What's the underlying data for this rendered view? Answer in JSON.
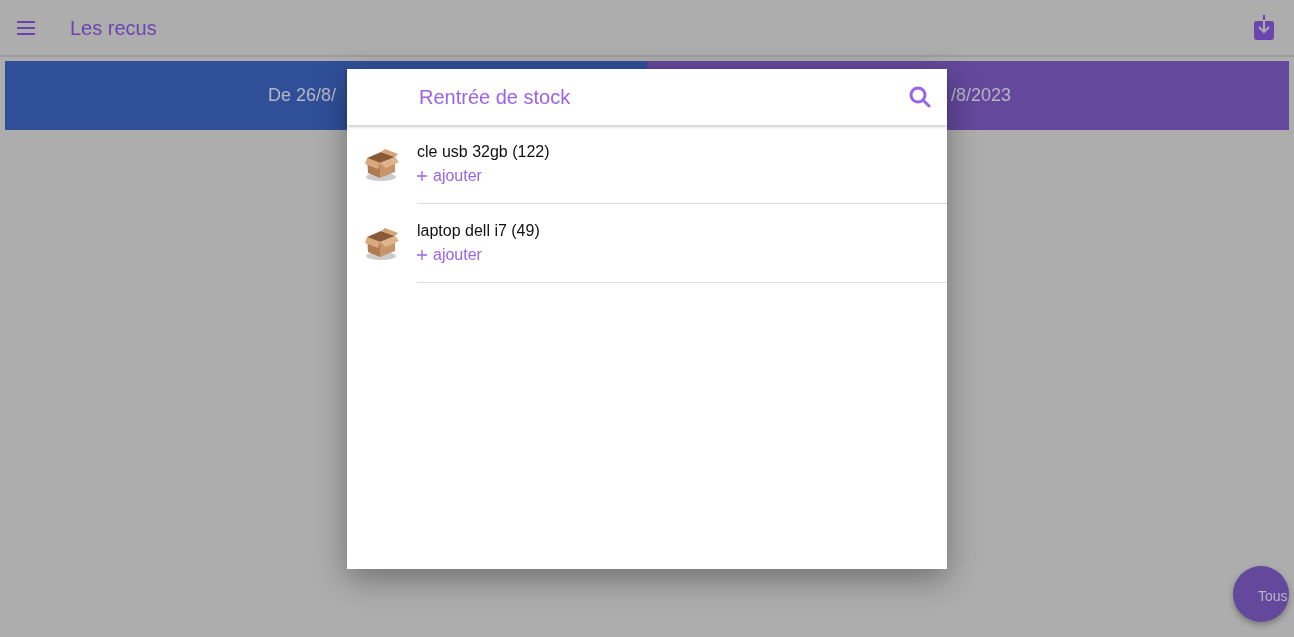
{
  "app_bar": {
    "title": "Les recus"
  },
  "date_tabs": [
    {
      "label": "De 26/8/",
      "color": "#2f4f98"
    },
    {
      "label": "/8/2023",
      "color": "#63489c"
    }
  ],
  "dialog": {
    "title": "Rentrée de stock",
    "items": [
      {
        "name": "cle usb 32gb (122)",
        "action": "ajouter"
      },
      {
        "name": "laptop dell i7 (49)",
        "action": "ajouter"
      }
    ]
  },
  "fab": {
    "label": "Tous"
  }
}
